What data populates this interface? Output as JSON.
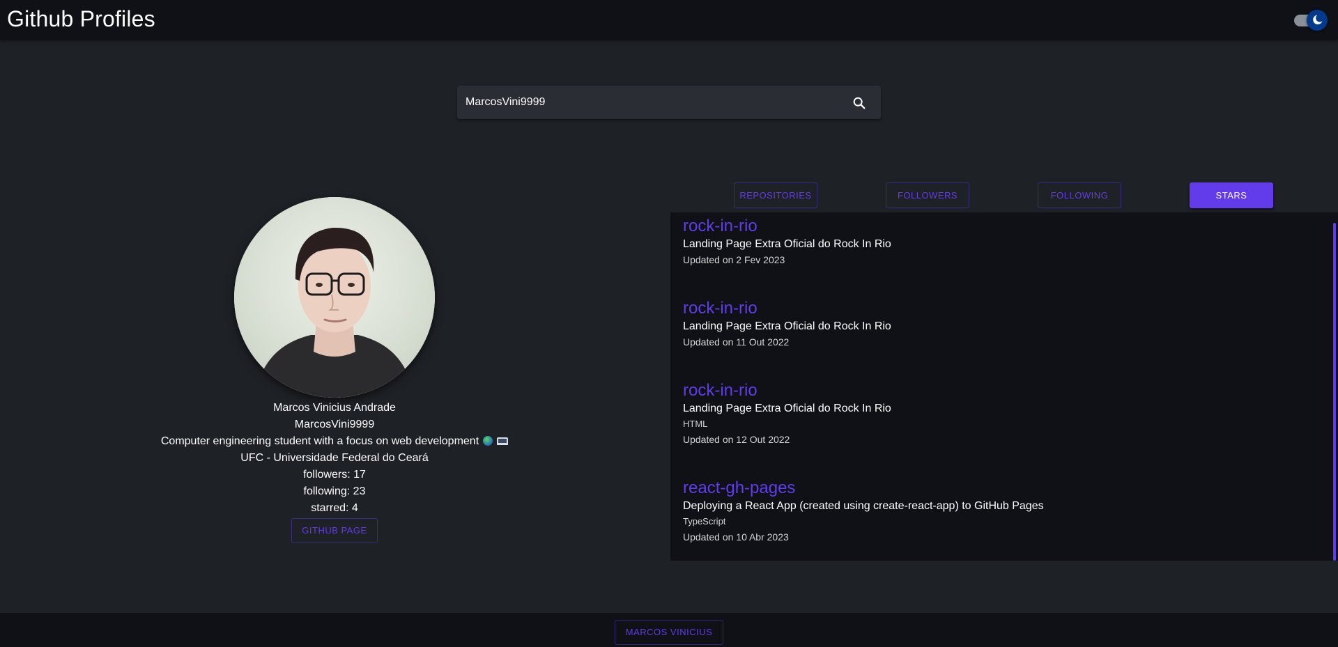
{
  "app": {
    "title": "Github Profiles"
  },
  "search": {
    "value": "MarcosVini9999"
  },
  "profile": {
    "name": "Marcos Vinicius Andrade",
    "login": "MarcosVini9999",
    "bio": "Computer engineering student with a focus on web development",
    "company": "UFC - Universidade Federal do Ceará",
    "followers": "followers: 17",
    "following": "following: 23",
    "starred": "starred: 4",
    "github_button": "GITHUB PAGE"
  },
  "tabs": [
    {
      "label": "REPOSITORIES",
      "active": false
    },
    {
      "label": "FOLLOWERS",
      "active": false
    },
    {
      "label": "FOLLOWING",
      "active": false
    },
    {
      "label": "STARS",
      "active": true
    }
  ],
  "repos": [
    {
      "name": "rock-in-rio",
      "description": "Landing Page Extra Oficial do Rock In Rio",
      "language": "",
      "updated": "Updated on 2 Fev 2023"
    },
    {
      "name": "rock-in-rio",
      "description": "Landing Page Extra Oficial do Rock In Rio",
      "language": "",
      "updated": "Updated on 11 Out 2022"
    },
    {
      "name": "rock-in-rio",
      "description": "Landing Page Extra Oficial do Rock In Rio",
      "language": "HTML",
      "updated": "Updated on 12 Out 2022"
    },
    {
      "name": "react-gh-pages",
      "description": "Deploying a React App (created using create-react-app) to GitHub Pages",
      "language": "TypeScript",
      "updated": "Updated on 10 Abr 2023"
    }
  ],
  "footer": {
    "button": "MARCOS VINICIUS"
  },
  "colors": {
    "accent": "#623cea",
    "background": "#1e2126",
    "appbar": "#0f1117",
    "search_bg": "#2a2d33",
    "toggle_thumb": "#003a8c"
  },
  "icons": {
    "search": "search-icon",
    "theme": "moon-icon",
    "bio_emoji_1": "globe-icon",
    "bio_emoji_2": "laptop-icon"
  }
}
